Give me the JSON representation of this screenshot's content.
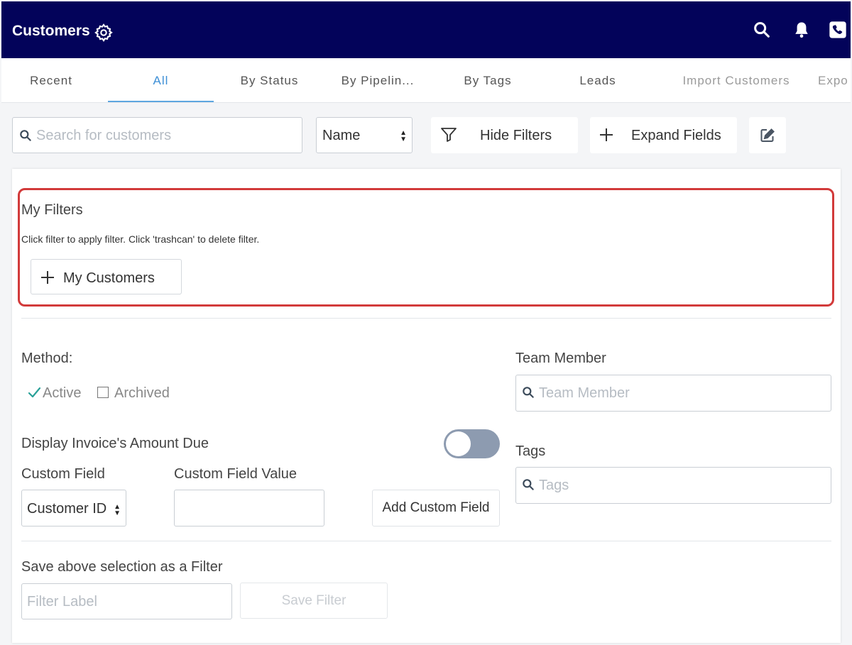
{
  "header": {
    "title": "Customers",
    "icons": [
      "gear-icon",
      "search-icon",
      "bell-icon",
      "phone-icon"
    ],
    "background": "#03035a"
  },
  "tabs": [
    {
      "label": "Recent"
    },
    {
      "label": "All",
      "active": true
    },
    {
      "label": "By Status"
    },
    {
      "label": "By Pipelin..."
    },
    {
      "label": "By Tags"
    },
    {
      "label": "Leads"
    },
    {
      "label": "Import Customers"
    },
    {
      "label": "Expo"
    }
  ],
  "toolbar": {
    "search_placeholder": "Search for customers",
    "sort_value": "Name",
    "hide_filters_label": "Hide Filters",
    "expand_fields_label": "Expand Fields",
    "edit_icon": "pencil-square-icon"
  },
  "my_filters": {
    "title": "My Filters",
    "help_text": "Click filter to apply filter. Click 'trashcan' to delete filter.",
    "items": [
      {
        "label": "My Customers"
      }
    ],
    "highlight_color": "#d23a3a"
  },
  "filters": {
    "method_label": "Method:",
    "active_label": "Active",
    "active_checked": true,
    "archived_label": "Archived",
    "archived_checked": false,
    "display_amount_label": "Display Invoice's Amount Due",
    "display_amount_on": false,
    "custom_field_label": "Custom Field",
    "custom_field_value": "Customer ID",
    "custom_field_value_label": "Custom Field Value",
    "custom_field_input": "",
    "add_custom_field_label": "Add Custom Field",
    "team_member_label": "Team Member",
    "team_member_placeholder": "Team Member",
    "tags_label": "Tags",
    "tags_placeholder": "Tags"
  },
  "save_filter": {
    "label": "Save above selection as a Filter",
    "input_placeholder": "Filter Label",
    "button_label": "Save Filter"
  },
  "colors": {
    "accent": "#3d8fd6",
    "check": "#2aa198",
    "toggle_off": "#8d9bb0"
  }
}
